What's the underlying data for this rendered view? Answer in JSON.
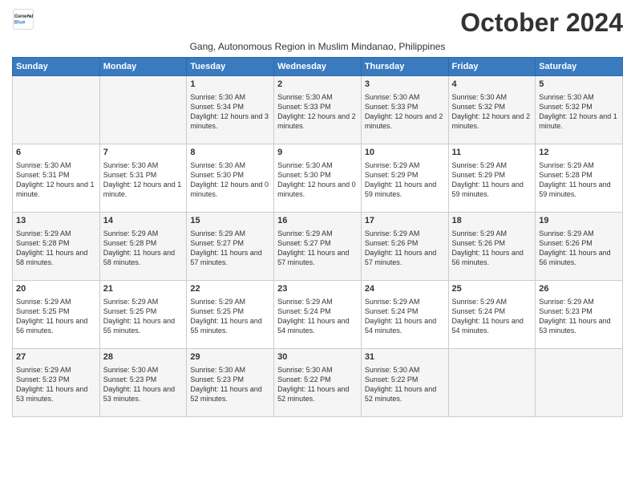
{
  "logo": {
    "line1": "General",
    "line2": "Blue"
  },
  "title": "October 2024",
  "subtitle": "Gang, Autonomous Region in Muslim Mindanao, Philippines",
  "days_of_week": [
    "Sunday",
    "Monday",
    "Tuesday",
    "Wednesday",
    "Thursday",
    "Friday",
    "Saturday"
  ],
  "weeks": [
    [
      {
        "day": "",
        "content": ""
      },
      {
        "day": "",
        "content": ""
      },
      {
        "day": "1",
        "content": "Sunrise: 5:30 AM\nSunset: 5:34 PM\nDaylight: 12 hours and 3 minutes."
      },
      {
        "day": "2",
        "content": "Sunrise: 5:30 AM\nSunset: 5:33 PM\nDaylight: 12 hours and 2 minutes."
      },
      {
        "day": "3",
        "content": "Sunrise: 5:30 AM\nSunset: 5:33 PM\nDaylight: 12 hours and 2 minutes."
      },
      {
        "day": "4",
        "content": "Sunrise: 5:30 AM\nSunset: 5:32 PM\nDaylight: 12 hours and 2 minutes."
      },
      {
        "day": "5",
        "content": "Sunrise: 5:30 AM\nSunset: 5:32 PM\nDaylight: 12 hours and 1 minute."
      }
    ],
    [
      {
        "day": "6",
        "content": "Sunrise: 5:30 AM\nSunset: 5:31 PM\nDaylight: 12 hours and 1 minute."
      },
      {
        "day": "7",
        "content": "Sunrise: 5:30 AM\nSunset: 5:31 PM\nDaylight: 12 hours and 1 minute."
      },
      {
        "day": "8",
        "content": "Sunrise: 5:30 AM\nSunset: 5:30 PM\nDaylight: 12 hours and 0 minutes."
      },
      {
        "day": "9",
        "content": "Sunrise: 5:30 AM\nSunset: 5:30 PM\nDaylight: 12 hours and 0 minutes."
      },
      {
        "day": "10",
        "content": "Sunrise: 5:29 AM\nSunset: 5:29 PM\nDaylight: 11 hours and 59 minutes."
      },
      {
        "day": "11",
        "content": "Sunrise: 5:29 AM\nSunset: 5:29 PM\nDaylight: 11 hours and 59 minutes."
      },
      {
        "day": "12",
        "content": "Sunrise: 5:29 AM\nSunset: 5:28 PM\nDaylight: 11 hours and 59 minutes."
      }
    ],
    [
      {
        "day": "13",
        "content": "Sunrise: 5:29 AM\nSunset: 5:28 PM\nDaylight: 11 hours and 58 minutes."
      },
      {
        "day": "14",
        "content": "Sunrise: 5:29 AM\nSunset: 5:28 PM\nDaylight: 11 hours and 58 minutes."
      },
      {
        "day": "15",
        "content": "Sunrise: 5:29 AM\nSunset: 5:27 PM\nDaylight: 11 hours and 57 minutes."
      },
      {
        "day": "16",
        "content": "Sunrise: 5:29 AM\nSunset: 5:27 PM\nDaylight: 11 hours and 57 minutes."
      },
      {
        "day": "17",
        "content": "Sunrise: 5:29 AM\nSunset: 5:26 PM\nDaylight: 11 hours and 57 minutes."
      },
      {
        "day": "18",
        "content": "Sunrise: 5:29 AM\nSunset: 5:26 PM\nDaylight: 11 hours and 56 minutes."
      },
      {
        "day": "19",
        "content": "Sunrise: 5:29 AM\nSunset: 5:26 PM\nDaylight: 11 hours and 56 minutes."
      }
    ],
    [
      {
        "day": "20",
        "content": "Sunrise: 5:29 AM\nSunset: 5:25 PM\nDaylight: 11 hours and 56 minutes."
      },
      {
        "day": "21",
        "content": "Sunrise: 5:29 AM\nSunset: 5:25 PM\nDaylight: 11 hours and 55 minutes."
      },
      {
        "day": "22",
        "content": "Sunrise: 5:29 AM\nSunset: 5:25 PM\nDaylight: 11 hours and 55 minutes."
      },
      {
        "day": "23",
        "content": "Sunrise: 5:29 AM\nSunset: 5:24 PM\nDaylight: 11 hours and 54 minutes."
      },
      {
        "day": "24",
        "content": "Sunrise: 5:29 AM\nSunset: 5:24 PM\nDaylight: 11 hours and 54 minutes."
      },
      {
        "day": "25",
        "content": "Sunrise: 5:29 AM\nSunset: 5:24 PM\nDaylight: 11 hours and 54 minutes."
      },
      {
        "day": "26",
        "content": "Sunrise: 5:29 AM\nSunset: 5:23 PM\nDaylight: 11 hours and 53 minutes."
      }
    ],
    [
      {
        "day": "27",
        "content": "Sunrise: 5:29 AM\nSunset: 5:23 PM\nDaylight: 11 hours and 53 minutes."
      },
      {
        "day": "28",
        "content": "Sunrise: 5:30 AM\nSunset: 5:23 PM\nDaylight: 11 hours and 53 minutes."
      },
      {
        "day": "29",
        "content": "Sunrise: 5:30 AM\nSunset: 5:23 PM\nDaylight: 11 hours and 52 minutes."
      },
      {
        "day": "30",
        "content": "Sunrise: 5:30 AM\nSunset: 5:22 PM\nDaylight: 11 hours and 52 minutes."
      },
      {
        "day": "31",
        "content": "Sunrise: 5:30 AM\nSunset: 5:22 PM\nDaylight: 11 hours and 52 minutes."
      },
      {
        "day": "",
        "content": ""
      },
      {
        "day": "",
        "content": ""
      }
    ]
  ]
}
